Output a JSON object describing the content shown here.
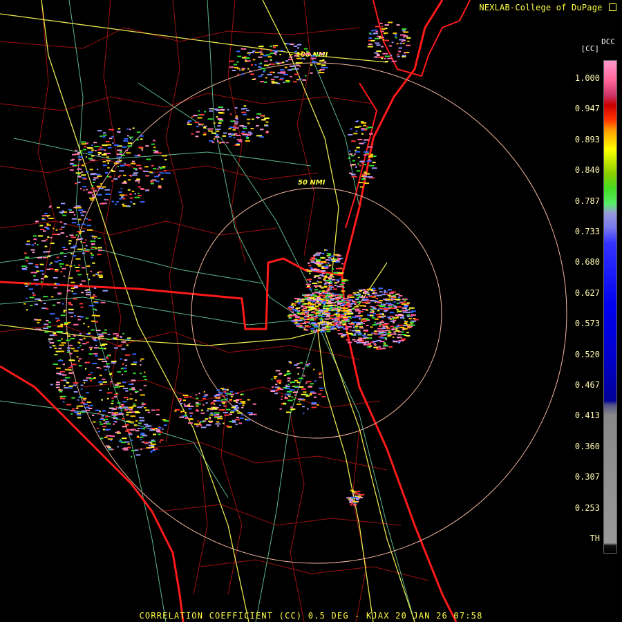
{
  "credit": "NEXLAB-College of DuPage",
  "credit_icon": "external-link-icon",
  "product": {
    "name": "DCC",
    "unit": "[CC]"
  },
  "footer": "CORRELATION COEFFICIENT (CC) 0.5 DEG - KJAX 20 JAN 26 07:58",
  "range_rings": [
    "100 NMI",
    "50 NMI"
  ],
  "colorbar": {
    "labels": [
      "1.000",
      "0.947",
      "0.893",
      "0.840",
      "0.787",
      "0.733",
      "0.680",
      "0.627",
      "0.573",
      "0.520",
      "0.467",
      "0.413",
      "0.360",
      "0.307",
      "0.253",
      "TH"
    ]
  },
  "colors": {
    "state_border": "#ff1a1a",
    "county_border": "#a01010",
    "highway": "#e8e850",
    "road": "#66cc99",
    "range_ring": "#f4b8a0",
    "echo_palette": [
      "#ff99cc",
      "#ffcc00",
      "#ffff33",
      "#33dd33",
      "#3366ff",
      "#ff3333",
      "#9999ff",
      "#ff66aa"
    ]
  }
}
